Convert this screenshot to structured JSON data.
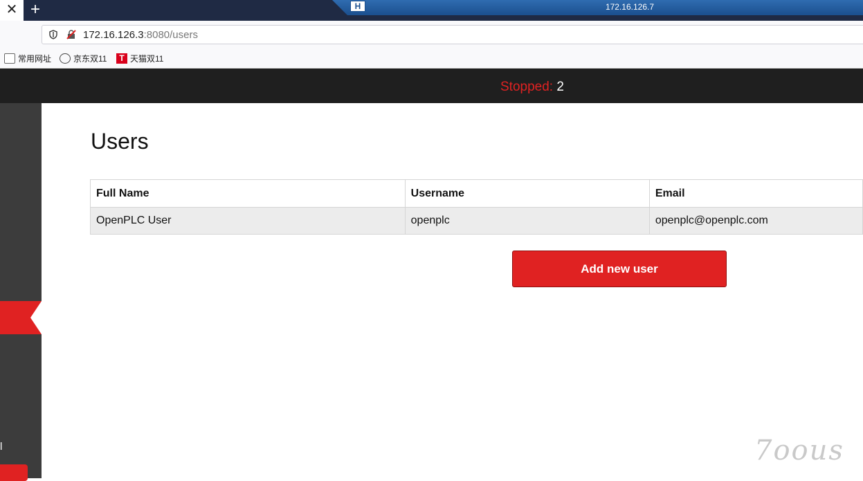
{
  "browser": {
    "close_glyph": "✕",
    "new_tab_glyph": "+",
    "remote_title": "172.16.126.7",
    "remote_pin_glyph": "H",
    "url_host": "172.16.126.3",
    "url_rest": ":8080/users",
    "bookmarks": [
      {
        "label": "常用网址",
        "icon": "folder-icon"
      },
      {
        "label": "京东双11",
        "icon": "globe-icon"
      },
      {
        "label": "天猫双11",
        "icon": "tmall-icon",
        "glyph": "T"
      }
    ]
  },
  "topbar": {
    "status_label": "Stopped:",
    "status_value": "2"
  },
  "sidebar": {
    "partial_text": "l"
  },
  "main": {
    "title": "Users",
    "table": {
      "headers": [
        "Full Name",
        "Username",
        "Email"
      ],
      "rows": [
        [
          "OpenPLC User",
          "openplc",
          "openplc@openplc.com"
        ]
      ]
    },
    "add_button": "Add new user"
  },
  "watermark": "7oous",
  "colors": {
    "accent_red": "#e02222",
    "topbar": "#1f1f1f",
    "sidebar": "#3c3c3c"
  }
}
